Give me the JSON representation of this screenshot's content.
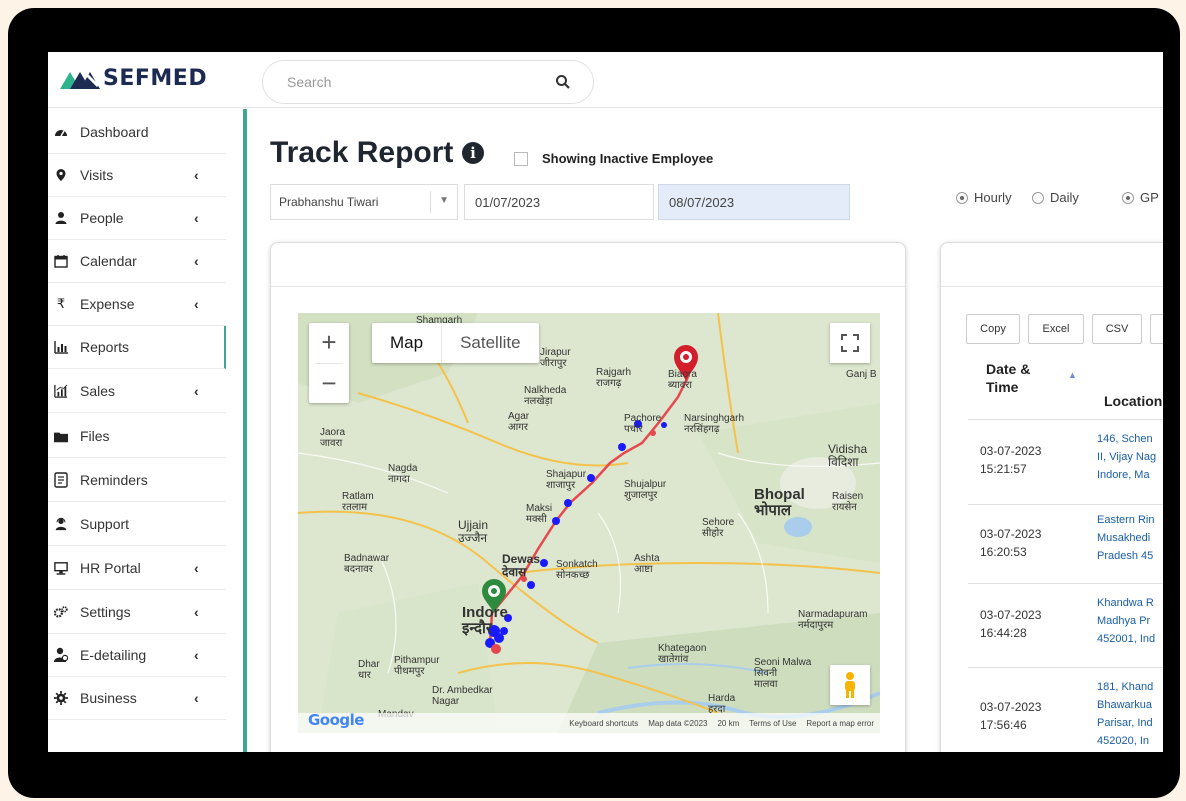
{
  "brand": {
    "logo_text": "SEFMED"
  },
  "search": {
    "placeholder": "Search"
  },
  "sidebar": {
    "items": [
      {
        "label": "Dashboard",
        "icon": "dashboard-icon",
        "chevron": false
      },
      {
        "label": "Visits",
        "icon": "map-pin-icon",
        "chevron": true
      },
      {
        "label": "People",
        "icon": "user-icon",
        "chevron": true
      },
      {
        "label": "Calendar",
        "icon": "calendar-icon",
        "chevron": true
      },
      {
        "label": "Expense",
        "icon": "rupee-icon",
        "chevron": true
      },
      {
        "label": "Reports",
        "icon": "bar-chart-icon",
        "chevron": false,
        "active": true
      },
      {
        "label": "Sales",
        "icon": "sales-chart-icon",
        "chevron": true
      },
      {
        "label": "Files",
        "icon": "folder-icon",
        "chevron": false
      },
      {
        "label": "Reminders",
        "icon": "reminder-icon",
        "chevron": false
      },
      {
        "label": "Support",
        "icon": "support-icon",
        "chevron": false
      },
      {
        "label": "HR Portal",
        "icon": "monitor-icon",
        "chevron": true
      },
      {
        "label": "Settings",
        "icon": "gears-icon",
        "chevron": true
      },
      {
        "label": "E-detailing",
        "icon": "user-tie-icon",
        "chevron": true
      },
      {
        "label": "Business",
        "icon": "business-icon",
        "chevron": true
      }
    ]
  },
  "page": {
    "title": "Track Report",
    "inactive_label": "Showing Inactive Employee",
    "employee": "Prabhanshu Tiwari",
    "date_from": "01/07/2023",
    "date_to": "08/07/2023",
    "radio_hourly": "Hourly",
    "radio_daily": "Daily",
    "radio_gps": "GP"
  },
  "map": {
    "type_map": "Map",
    "type_satellite": "Satellite",
    "google_logo": "Google",
    "footer": [
      "Keyboard shortcuts",
      "Map data ©2023",
      "20 km",
      "Terms of Use",
      "Report a map error"
    ],
    "labels": [
      {
        "t": "Shamgarh"
      },
      {
        "t": "Jirapur\nजीरापुर"
      },
      {
        "t": "Rajgarh\nराजगढ़"
      },
      {
        "t": "Biaora\nब्यावरा"
      },
      {
        "t": "Nalkheda\nनलखेड़ा"
      },
      {
        "t": "Jaora\nजावरा"
      },
      {
        "t": "Agar\nआगर"
      },
      {
        "t": "Pachore\nपचोर"
      },
      {
        "t": "Narsinghgarh\nनरसिंहगढ़"
      },
      {
        "t": "Ganj B"
      },
      {
        "t": "Vidisha\nविदिशा"
      },
      {
        "t": "Nagda\nनागदा"
      },
      {
        "t": "Shajapur\nशाजापुर"
      },
      {
        "t": "Shujalpur\nशुजालपुर"
      },
      {
        "t": "Ratlam\nरतलाम"
      },
      {
        "t": "Maksi\nमक्सी"
      },
      {
        "t": "Bhopal\nभोपाल"
      },
      {
        "t": "Raisen\nरायसेन"
      },
      {
        "t": "Ujjain\nउज्जैन"
      },
      {
        "t": "Sehore\nसीहोर"
      },
      {
        "t": "Badnawar\nबदनावर"
      },
      {
        "t": "Dewas\nदेवास"
      },
      {
        "t": "Sonkatch\nसोनकच्छ"
      },
      {
        "t": "Ashta\nआष्टा"
      },
      {
        "t": "Indore\nइन्दौर"
      },
      {
        "t": "Narmadapuram\nनर्मदापुरम"
      },
      {
        "t": "Khategaon\nखातेगांव"
      },
      {
        "t": "Dhar\nधार"
      },
      {
        "t": "Pithampur\nपीथमपुर"
      },
      {
        "t": "Seoni Malwa\nसिवनी\nमालवा"
      },
      {
        "t": "Dr. Ambedkar\nNagar"
      },
      {
        "t": "Harda\nहरदा"
      },
      {
        "t": "Mandav"
      }
    ]
  },
  "table": {
    "buttons": [
      "Copy",
      "Excel",
      "CSV"
    ],
    "headers": {
      "date": "Date & Time",
      "location": "Location"
    },
    "rows": [
      {
        "date": "03-07-2023",
        "time": "15:21:57",
        "loc1": "146, Schen",
        "loc2": "II, Vijay Nag",
        "loc3": "Indore, Ma"
      },
      {
        "date": "03-07-2023",
        "time": "16:20:53",
        "loc1": "Eastern Rin",
        "loc2": "Musakhedi",
        "loc3": "Pradesh 45"
      },
      {
        "date": "03-07-2023",
        "time": "16:44:28",
        "loc1": "Khandwa R",
        "loc2": "Madhya Pr",
        "loc3": "452001, Ind"
      },
      {
        "date": "03-07-2023",
        "time": "17:56:46",
        "loc1": "181, Khand",
        "loc2": "Bhawarkua",
        "loc3": "Parisar, Ind",
        "loc4": "452020, In"
      }
    ]
  },
  "colors": {
    "accent": "#3fa68f",
    "brand": "#1d2b52",
    "route": "#e5484d",
    "marker": "#1a1aff"
  }
}
